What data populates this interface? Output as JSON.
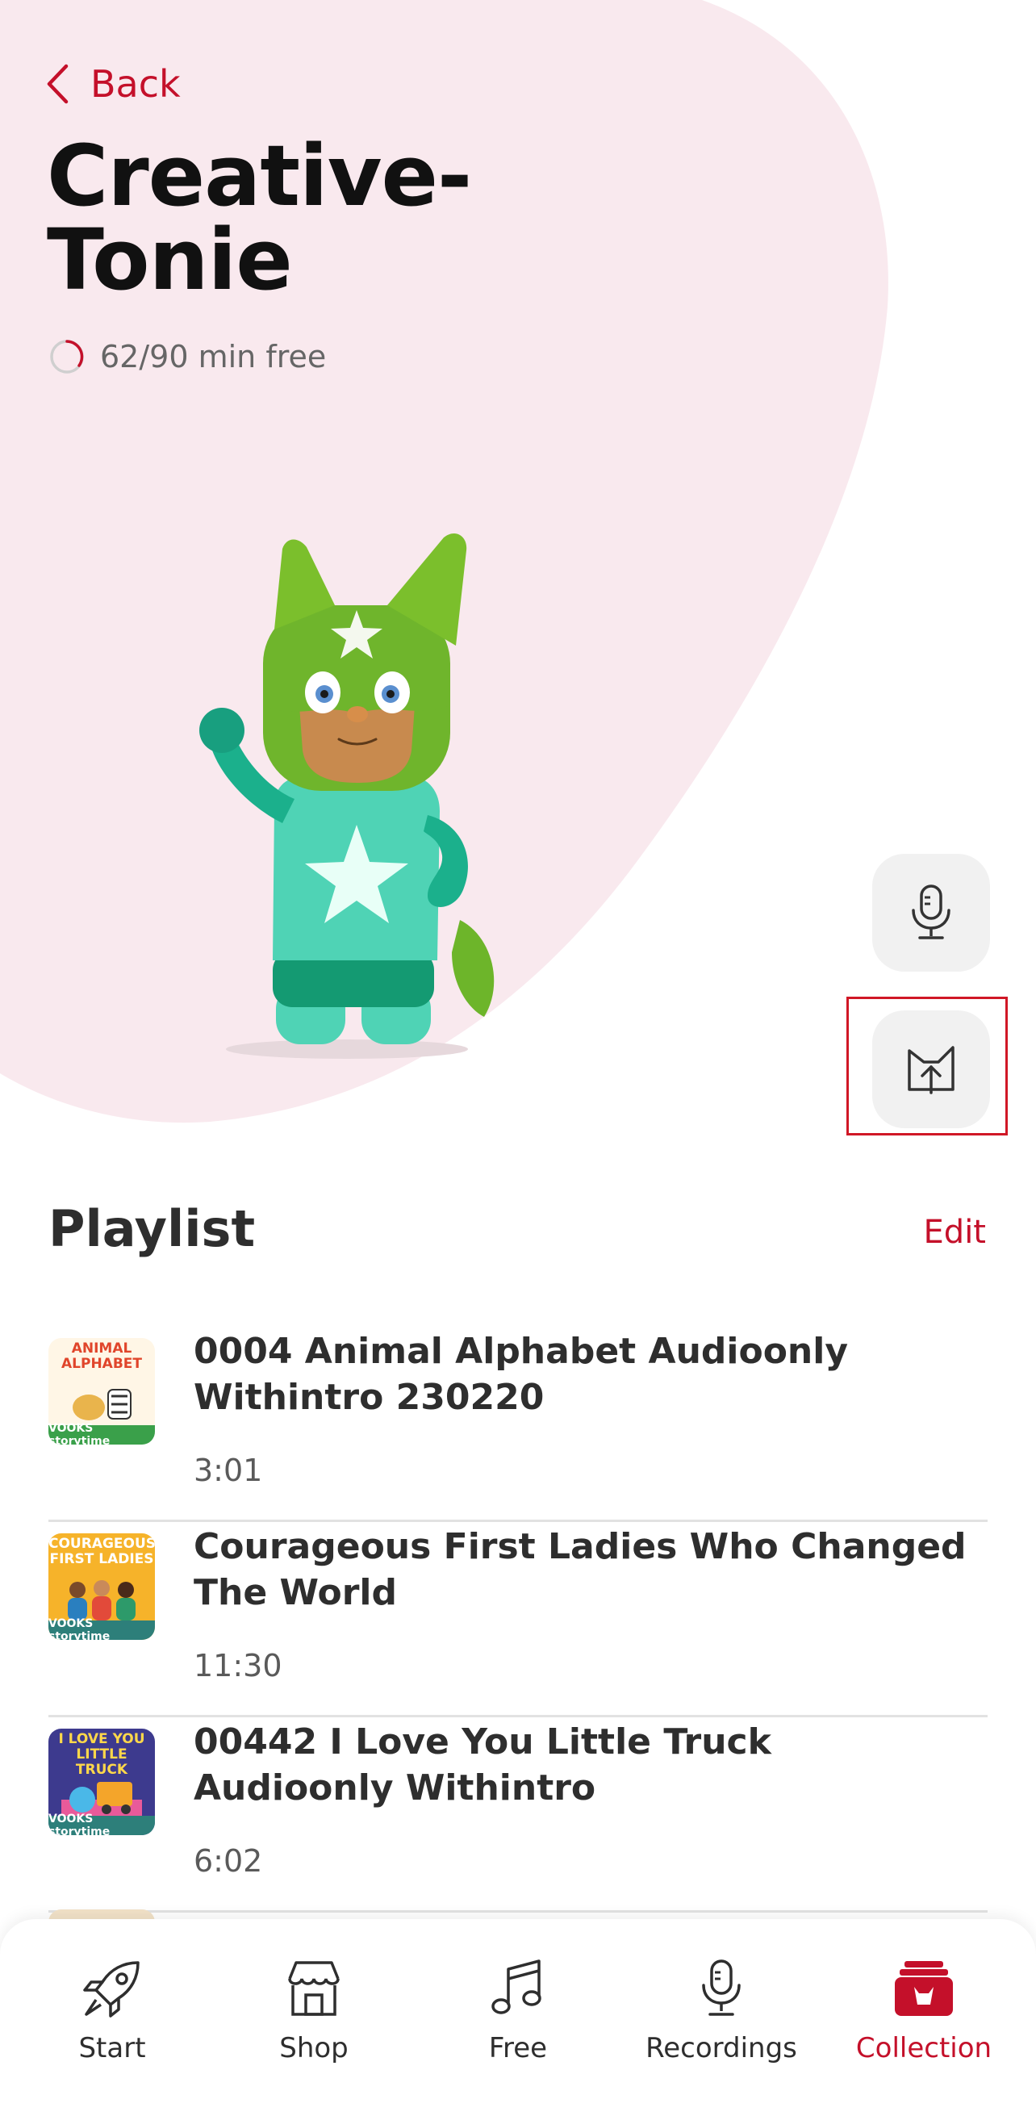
{
  "header": {
    "back_label": "Back",
    "title_line1": "Creative-",
    "title_line2": "Tonie",
    "free_time": "62/90 min free"
  },
  "colors": {
    "accent": "#c4102a",
    "blob": "#f9e9ee",
    "figure_green": "#7bb82a",
    "figure_teal": "#4fd3b5"
  },
  "actions": {
    "record_icon": "microphone-icon",
    "upload_icon": "tonie-upload-icon"
  },
  "playlist": {
    "heading": "Playlist",
    "edit_label": "Edit",
    "tracks": [
      {
        "title": "0004 Animal Alphabet Audioonly Withintro 230220",
        "duration": "3:01",
        "cover_text": "ANIMAL ALPHABET",
        "cover_label": "VOOKS storytime"
      },
      {
        "title": "Courageous First Ladies Who Changed The World",
        "duration": "11:30",
        "cover_text": "COURAGEOUS FIRST LADIES",
        "cover_label": "VOOKS storytime"
      },
      {
        "title": "00442 I Love You Little Truck Audioonly Withintro",
        "duration": "6:02",
        "cover_text": "I LOVE YOU LITTLE TRUCK",
        "cover_label": "VOOKS storytime"
      }
    ]
  },
  "tabbar": {
    "tabs": [
      {
        "label": "Start",
        "icon": "rocket-icon"
      },
      {
        "label": "Shop",
        "icon": "shop-icon"
      },
      {
        "label": "Free",
        "icon": "music-note-icon"
      },
      {
        "label": "Recordings",
        "icon": "microphone-icon"
      },
      {
        "label": "Collection",
        "icon": "collection-icon",
        "active": true
      }
    ]
  }
}
